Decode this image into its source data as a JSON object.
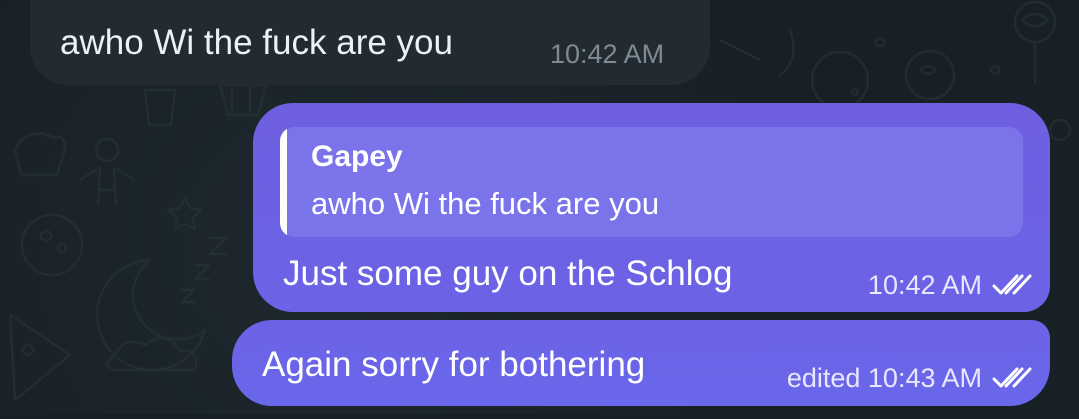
{
  "chat": {
    "messages": [
      {
        "direction": "incoming",
        "text": "awho Wi the fuck are you",
        "time": "10:42 AM"
      },
      {
        "direction": "outgoing",
        "reply_to": {
          "author": "Gapey",
          "text": "awho Wi the fuck are you"
        },
        "text": "Just some guy on the Schlog",
        "time": "10:42 AM",
        "status_icon": "double-check-icon"
      },
      {
        "direction": "outgoing",
        "text": "Again sorry for bothering",
        "edited_time": "edited 10:43 AM",
        "status_icon": "double-check-icon"
      }
    ]
  },
  "colors": {
    "background": "#172025",
    "incoming_bubble": "#222b31",
    "outgoing_bubble": "#6b63e6",
    "quote_bar": "#ffffff"
  }
}
